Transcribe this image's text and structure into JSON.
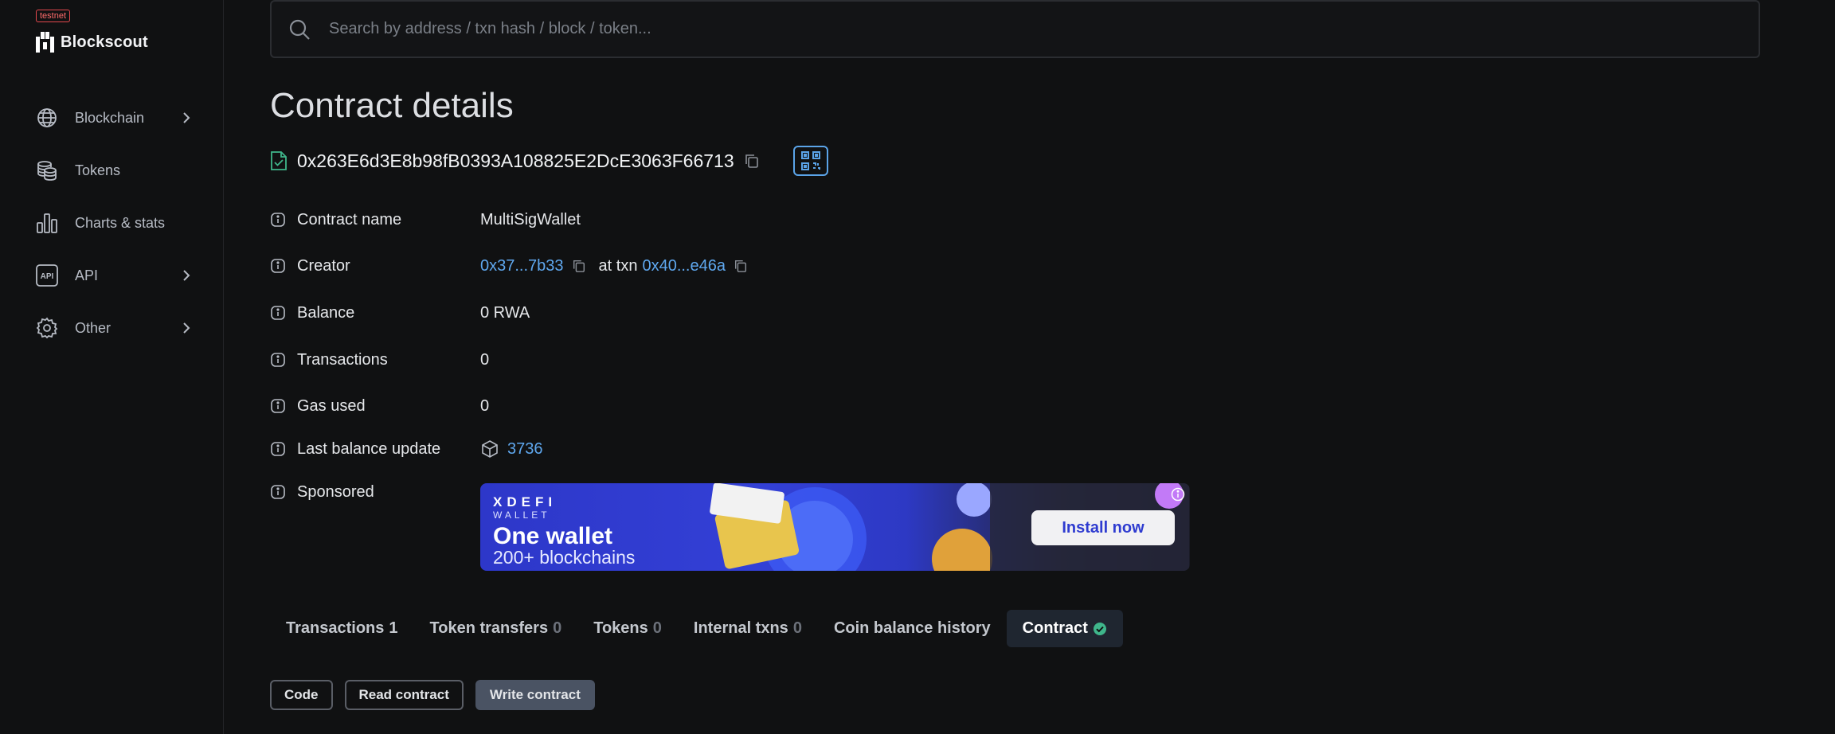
{
  "sidebar": {
    "badge": "testnet",
    "brand": "Blockscout",
    "items": [
      {
        "label": "Blockchain",
        "icon": "globe-icon",
        "expandable": true
      },
      {
        "label": "Tokens",
        "icon": "coins-icon",
        "expandable": false
      },
      {
        "label": "Charts & stats",
        "icon": "bar-chart-icon",
        "expandable": false
      },
      {
        "label": "API",
        "icon": "api-icon",
        "expandable": true
      },
      {
        "label": "Other",
        "icon": "gear-icon",
        "expandable": true
      }
    ]
  },
  "search": {
    "placeholder": "Search by address / txn hash / block / token..."
  },
  "page": {
    "title": "Contract details",
    "address": "0x263E6d3E8b98fB0393A108825E2DcE3063F66713"
  },
  "details": {
    "contract_name": {
      "label": "Contract name",
      "value": "MultiSigWallet"
    },
    "creator": {
      "label": "Creator",
      "address": "0x37...7b33",
      "at_txn": "at txn",
      "txn": "0x40...e46a"
    },
    "balance": {
      "label": "Balance",
      "value": "0 RWA"
    },
    "transactions": {
      "label": "Transactions",
      "value": "0"
    },
    "gas_used": {
      "label": "Gas used",
      "value": "0"
    },
    "last_balance_update": {
      "label": "Last balance update",
      "value": "3736"
    },
    "sponsored": {
      "label": "Sponsored"
    }
  },
  "ad": {
    "brand": "XDEFI",
    "brand_sub": "WALLET",
    "headline": "One wallet",
    "tagline": "200+ blockchains",
    "cta": "Install now"
  },
  "tabs": [
    {
      "label": "Transactions",
      "count": "1",
      "count_muted": false
    },
    {
      "label": "Token transfers",
      "count": "0",
      "count_muted": true
    },
    {
      "label": "Tokens",
      "count": "0",
      "count_muted": true
    },
    {
      "label": "Internal txns",
      "count": "0",
      "count_muted": true
    },
    {
      "label": "Coin balance history",
      "count": "",
      "count_muted": true
    },
    {
      "label": "Contract",
      "count": "",
      "active": true,
      "verified": true
    }
  ],
  "subtabs": [
    {
      "label": "Code"
    },
    {
      "label": "Read contract"
    },
    {
      "label": "Write contract",
      "active": true
    }
  ],
  "colors": {
    "background": "#101112",
    "link": "#5fa8ef",
    "verified": "#3fb68b",
    "testnet": "#e5484d"
  }
}
